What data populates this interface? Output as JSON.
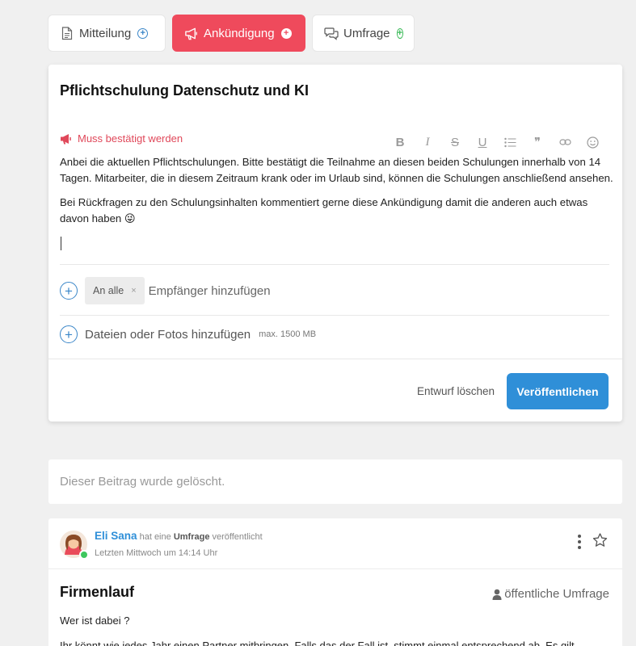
{
  "tabs": {
    "mitteilung": "Mitteilung",
    "ankuendigung": "Ankündigung",
    "umfrage": "Umfrage"
  },
  "composer": {
    "title": "Pflichtschulung Datenschutz und KI",
    "must_confirm": "Muss bestätigt werden",
    "paragraph1": "Anbei die aktuellen Pflichtschulungen. Bitte bestätigt die Teilnahme an diesen beiden Schulungen innerhalb von 14 Tagen. Mitarbeiter, die in diesem Zeitraum krank oder im Urlaub sind, können die Schulungen anschließend ansehen.",
    "paragraph2": "Bei Rückfragen zu den Schulungsinhalten kommentiert gerne diese Ankündigung damit die anderen auch etwas davon haben 😜",
    "recipient_chip": "An alle",
    "recipient_chip_remove": "×",
    "add_recipients": "Empfänger hinzufügen",
    "add_files": "Dateien oder Fotos hinzufügen",
    "max_size": "max. 1500 MB",
    "discard_draft": "Entwurf löschen",
    "publish": "Veröffentlichen"
  },
  "toolbar": {
    "bold": "B",
    "italic": "I",
    "strike": "S",
    "underline": "U",
    "quote": "❞"
  },
  "deleted_post": {
    "text": "Dieser Beitrag wurde gelöscht."
  },
  "post": {
    "author": "Eli Sana",
    "action_pre": "hat eine",
    "action_type": "Umfrage",
    "action_post": "veröffentlicht",
    "time": "Letzten Mittwoch um 14:14 Uhr",
    "title": "Firmenlauf",
    "visibility": "öffentliche Umfrage",
    "question": "Wer ist dabei ?",
    "body_partial": "Ihr könnt wie jedes Jahr einen Partner mitbringen. Falls das der Fall ist, stimmt einmal entsprechend ab. Es gilt"
  },
  "colors": {
    "accent_red": "#ef4a5c",
    "accent_blue": "#2f8fd8",
    "accent_green": "#3dbb5a",
    "background": "#f0f0f0"
  }
}
